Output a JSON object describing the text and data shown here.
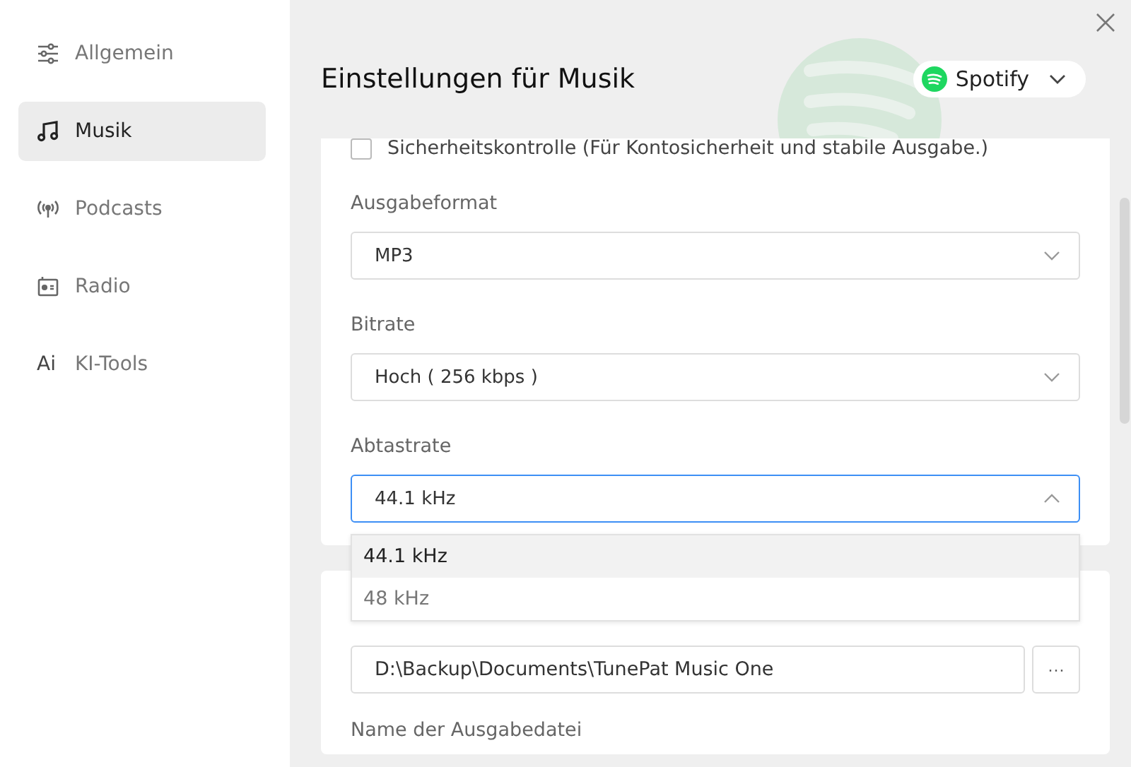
{
  "sidebar": {
    "items": [
      {
        "label": "Allgemein",
        "kind": "sliders",
        "selected": false
      },
      {
        "label": "Musik",
        "kind": "music",
        "selected": true
      },
      {
        "label": "Podcasts",
        "kind": "podcast",
        "selected": false
      },
      {
        "label": "Radio",
        "kind": "radio",
        "selected": false
      },
      {
        "label": "KI-Tools",
        "kind": "ai",
        "icon_label": "Ai",
        "selected": false
      }
    ]
  },
  "header": {
    "title": "Einstellungen für Musik",
    "source": "Spotify"
  },
  "checkbox": {
    "label": "Sicherheitskontrolle (Für Kontosicherheit und stabile Ausgabe.)",
    "checked": false
  },
  "selects": [
    {
      "label": "Ausgabeformat",
      "value": "MP3",
      "expanded": false
    },
    {
      "label": "Bitrate",
      "value": "Hoch ( 256 kbps )",
      "expanded": false
    },
    {
      "label": "Abtastrate",
      "value": "44.1 kHz",
      "expanded": true
    }
  ],
  "dropdown": {
    "options": [
      {
        "label": "44.1 kHz",
        "selected": true
      },
      {
        "label": "48 kHz",
        "selected": false
      }
    ]
  },
  "output_folder": {
    "value": "D:\\Backup\\Documents\\TunePat Music One",
    "browse": "···"
  },
  "file_name": {
    "label": "Name der Ausgabedatei"
  }
}
